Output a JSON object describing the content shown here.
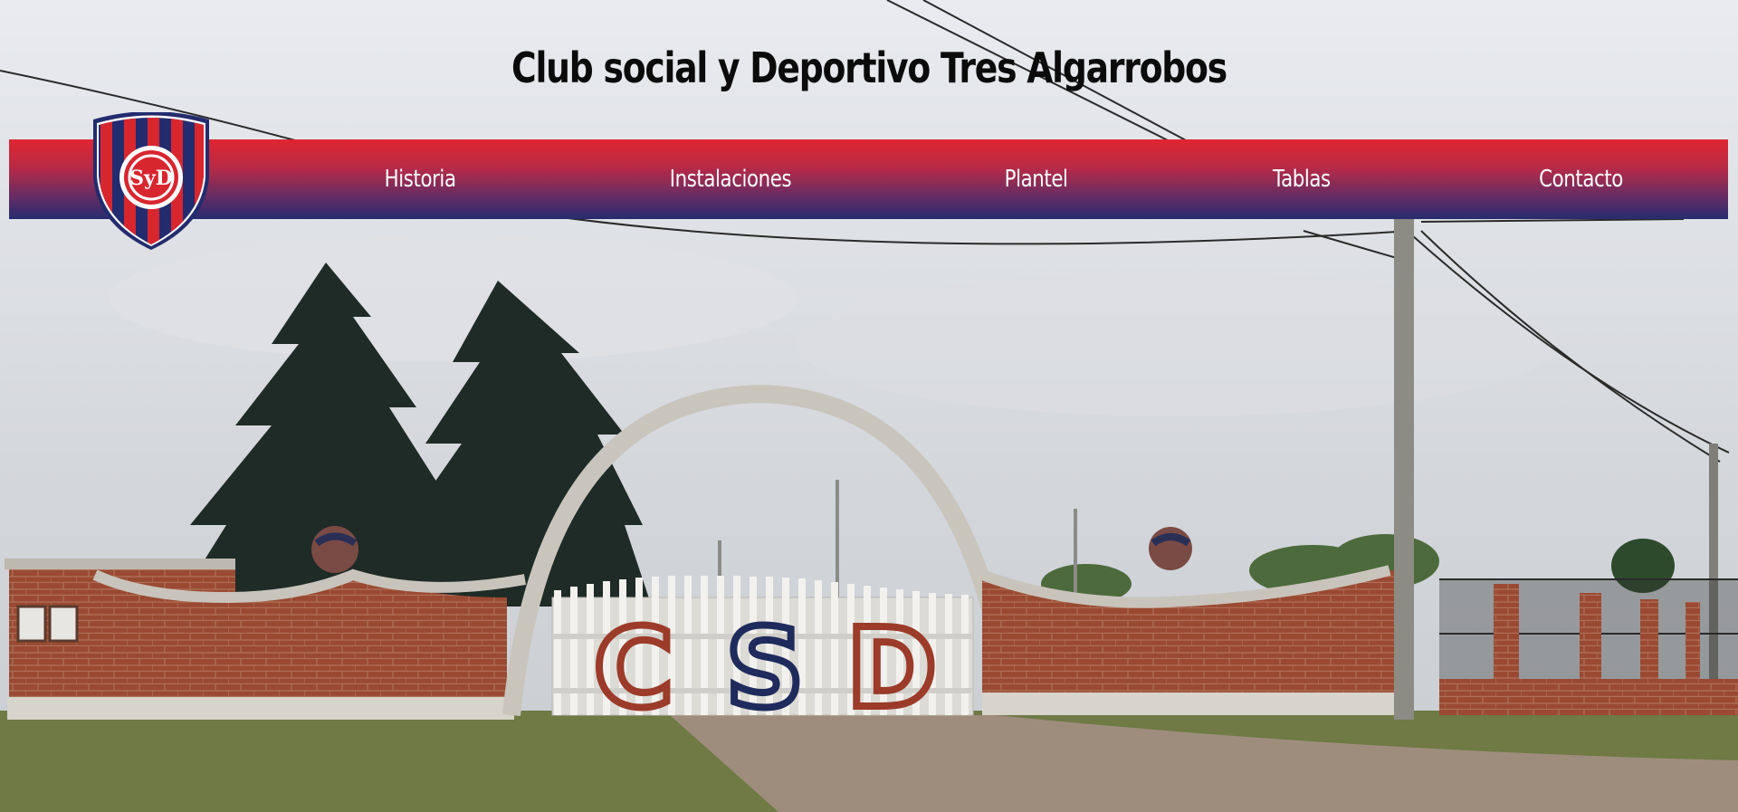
{
  "header": {
    "title": "Club social y Deportivo Tres Algarrobos"
  },
  "logo": {
    "monogram": "SyD",
    "colors": {
      "red": "#d8262f",
      "navy": "#232c6e",
      "white": "#ffffff"
    }
  },
  "nav": {
    "items": [
      {
        "label": "Historia"
      },
      {
        "label": "Instalaciones"
      },
      {
        "label": "Plantel"
      },
      {
        "label": "Tablas"
      },
      {
        "label": "Contacto"
      }
    ],
    "gradient": [
      "#e0252f",
      "#262c70"
    ]
  },
  "hero": {
    "gate_letters": [
      "C",
      "S",
      "D"
    ]
  }
}
